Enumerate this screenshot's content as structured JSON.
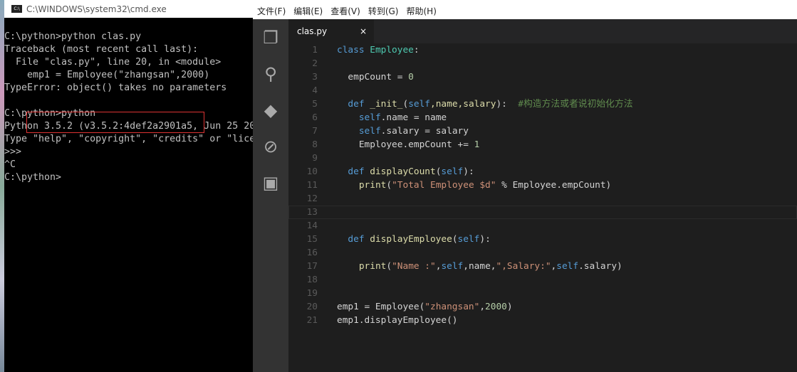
{
  "cmd": {
    "title": "C:\\WINDOWS\\system32\\cmd.exe",
    "icon": "C:\\",
    "lines": [
      "C:\\python>python clas.py",
      "Traceback (most recent call last):",
      "  File \"clas.py\", line 20, in <module>",
      "    emp1 = Employee(\"zhangsan\",2000)",
      "TypeError: object() takes no parameters",
      "",
      "C:\\python>python",
      "Python 3.5.2 (v3.5.2:4def2a2901a5, Jun 25 20",
      "Type \"help\", \"copyright\", \"credits\" or \"lice",
      ">>>",
      "^C",
      "C:\\python>"
    ]
  },
  "editor": {
    "menu": [
      "文件(F)",
      "编辑(E)",
      "查看(V)",
      "转到(G)",
      "帮助(H)"
    ],
    "activity": [
      "files-icon",
      "search-icon",
      "git-icon",
      "debug-icon",
      "extensions-icon"
    ],
    "tab": {
      "label": "clas.py",
      "close": "×"
    },
    "colors": {
      "keyword": "#569cd6",
      "class": "#4ec9b0",
      "function": "#dcdcaa",
      "string": "#ce9178",
      "number": "#b5cea8",
      "comment": "#608b4e"
    },
    "current_line": 13,
    "lines": [
      [
        [
          "class ",
          "kw"
        ],
        [
          "Employee",
          "cls"
        ],
        [
          ":",
          "t"
        ]
      ],
      [],
      [
        [
          "  empCount = ",
          "t"
        ],
        [
          "0",
          "n"
        ]
      ],
      [],
      [
        [
          "  def ",
          "kw"
        ],
        [
          "_init_",
          "fn"
        ],
        [
          "(",
          "t"
        ],
        [
          "self",
          "kw"
        ],
        [
          ",name,salary",
          "fn"
        ],
        [
          "):  ",
          "t"
        ],
        [
          "#构造方法或者说初始化方法",
          "cm"
        ]
      ],
      [
        [
          "    ",
          "t"
        ],
        [
          "self",
          "kw"
        ],
        [
          ".name = name",
          "t"
        ]
      ],
      [
        [
          "    ",
          "t"
        ],
        [
          "self",
          "kw"
        ],
        [
          ".salary = salary",
          "t"
        ]
      ],
      [
        [
          "    Employee.empCount += ",
          "t"
        ],
        [
          "1",
          "n"
        ]
      ],
      [],
      [
        [
          "  def ",
          "kw"
        ],
        [
          "displayCount",
          "fn"
        ],
        [
          "(",
          "t"
        ],
        [
          "self",
          "kw"
        ],
        [
          "):",
          "t"
        ]
      ],
      [
        [
          "    ",
          "t"
        ],
        [
          "print",
          "fn"
        ],
        [
          "(",
          "t"
        ],
        [
          "\"Total Employee $d\"",
          "str"
        ],
        [
          " % Employee.empCount)",
          "t"
        ]
      ],
      [],
      [],
      [],
      [
        [
          "  def ",
          "kw"
        ],
        [
          "displayEmployee",
          "fn"
        ],
        [
          "(",
          "t"
        ],
        [
          "self",
          "kw"
        ],
        [
          "):",
          "t"
        ]
      ],
      [],
      [
        [
          "    ",
          "t"
        ],
        [
          "print",
          "fn"
        ],
        [
          "(",
          "t"
        ],
        [
          "\"Name :\"",
          "str"
        ],
        [
          ",",
          "t"
        ],
        [
          "self",
          "kw"
        ],
        [
          ",name,",
          "t"
        ],
        [
          "\",Salary:\"",
          "str"
        ],
        [
          ",",
          "t"
        ],
        [
          "self",
          "kw"
        ],
        [
          ".salary)",
          "t"
        ]
      ],
      [],
      [],
      [
        [
          "emp1 = Employee(",
          "t"
        ],
        [
          "\"zhangsan\"",
          "str"
        ],
        [
          ",",
          "t"
        ],
        [
          "2000",
          "n"
        ],
        [
          ")",
          "t"
        ]
      ],
      [
        [
          "emp1.displayEmployee()",
          "t"
        ]
      ]
    ]
  }
}
